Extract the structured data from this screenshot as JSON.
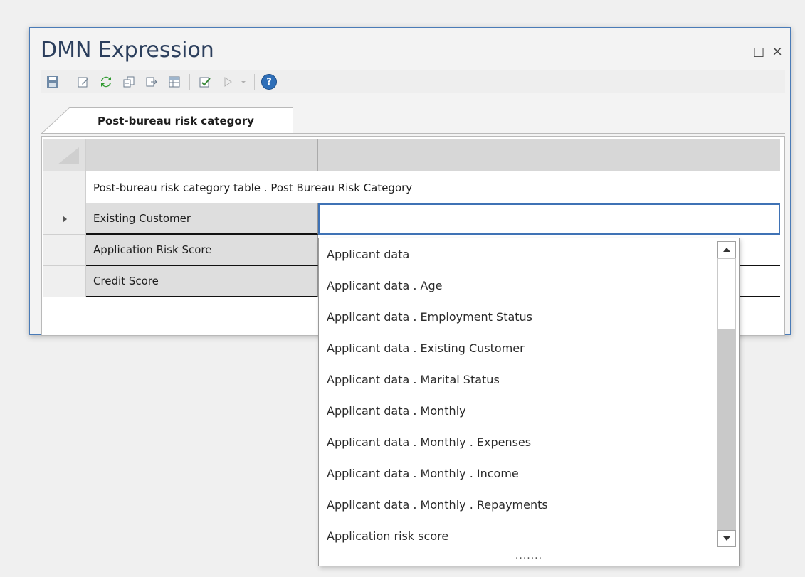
{
  "window": {
    "title": "DMN Expression",
    "maximize_glyph": "□",
    "close_glyph": "×"
  },
  "toolbar": {
    "icons": [
      "save-icon",
      "edit-icon",
      "refresh-icon",
      "import-icon",
      "export-icon",
      "copy-table-icon",
      "validate-icon",
      "run-icon",
      "run-dropdown-icon",
      "help-icon"
    ]
  },
  "tab": {
    "label": "Post-bureau risk category"
  },
  "grid": {
    "header_row": "Post-bureau risk category table . Post Bureau Risk Category",
    "rows": [
      {
        "name": "Existing Customer",
        "selected": true
      },
      {
        "name": "Application Risk Score"
      },
      {
        "name": "Credit Score"
      }
    ]
  },
  "dropdown": {
    "items": [
      "Applicant data",
      "Applicant data . Age",
      "Applicant data . Employment Status",
      "Applicant data . Existing Customer",
      "Applicant data . Marital Status",
      "Applicant data . Monthly",
      "Applicant data . Monthly . Expenses",
      "Applicant data . Monthly . Income",
      "Applicant data . Monthly . Repayments",
      "Application risk score"
    ],
    "grip": "......."
  },
  "colors": {
    "accent": "#2f6fb8",
    "window_border": "#4a7bb7",
    "title_text": "#2b3e5c"
  }
}
